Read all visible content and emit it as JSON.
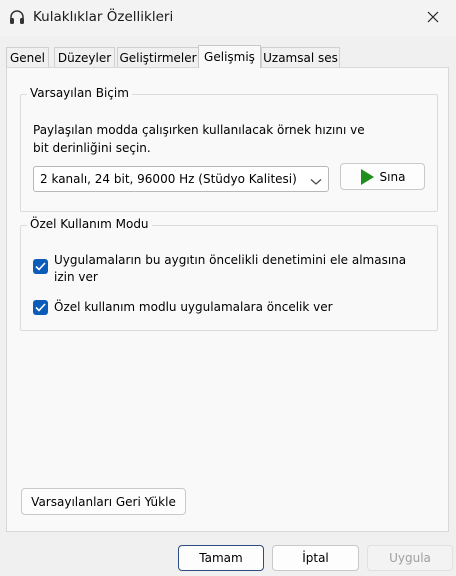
{
  "window": {
    "title": "Kulaklıklar Özellikleri",
    "app_icon": "headphones-icon",
    "close_icon": "close-icon"
  },
  "tabs": [
    {
      "label": "Genel",
      "active": false
    },
    {
      "label": "Düzeyler",
      "active": false
    },
    {
      "label": "Geliştirmeler",
      "active": false
    },
    {
      "label": "Gelişmiş",
      "active": true
    },
    {
      "label": "Uzamsal ses",
      "active": false
    }
  ],
  "default_format": {
    "legend": "Varsayılan Biçim",
    "description": "Paylaşılan modda çalışırken kullanılacak örnek hızını ve bit derinliğini seçin.",
    "selected_format": "2 kanalı, 24 bit, 96000 Hz (Stüdyo Kalitesi)",
    "test_button_label": "Sına",
    "test_icon": "play-icon"
  },
  "exclusive_mode": {
    "legend": "Özel Kullanım Modu",
    "options": [
      {
        "label": "Uygulamaların bu aygıtın öncelikli denetimini ele almasına izin ver",
        "checked": true
      },
      {
        "label": "Özel kullanım modlu uygulamalara öncelik ver",
        "checked": true
      }
    ]
  },
  "restore_defaults_label": "Varsayılanları Geri Yükle",
  "footer": {
    "ok_label": "Tamam",
    "cancel_label": "İptal",
    "apply_label": "Uygula",
    "apply_enabled": false
  },
  "colors": {
    "accent": "#0b5bb8",
    "play_green": "#1e8f1e",
    "disabled_text": "#a0a0a0"
  }
}
